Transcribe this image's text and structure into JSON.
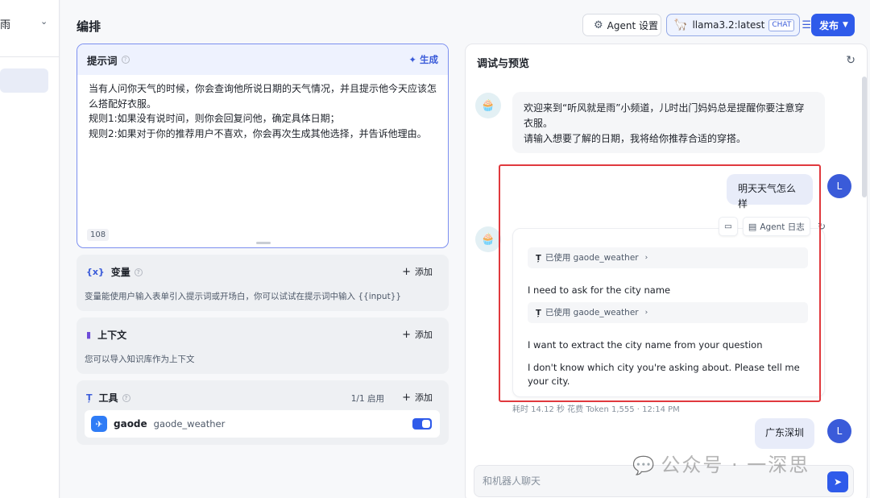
{
  "nav": {
    "partial_label": "雨"
  },
  "header": {
    "title": "编排",
    "agent_settings": "Agent 设置",
    "model_name": "llama3.2:latest",
    "model_badge": "CHAT",
    "publish": "发布"
  },
  "prompt": {
    "title": "提示词",
    "generate": "生成",
    "lines": [
      "当有人问你天气的时候，你会查询他所说日期的天气情况，并且提示他今天应该怎么搭配好衣服。",
      "规则1:如果没有说时间，则你会回复问他，确定具体日期；",
      "规则2:如果对于你的推荐用户不喜欢，你会再次生成其他选择，并告诉他理由。"
    ],
    "char_count": "108"
  },
  "variables": {
    "title": "变量",
    "add": "添加",
    "desc": "变量能使用户输入表单引入提示词或开场白，你可以试试在提示词中输入 {{input}}"
  },
  "context": {
    "title": "上下文",
    "add": "添加",
    "desc": "您可以导入知识库作为上下文"
  },
  "tools": {
    "title": "工具",
    "enabled": "1/1 启用",
    "add": "添加",
    "items": [
      {
        "name": "gaode",
        "id": "gaode_weather",
        "enabled": true
      }
    ]
  },
  "preview": {
    "title": "调试与预览",
    "welcome": [
      "欢迎来到“听风就是雨”小频道，儿时出门妈妈总是提醒你要注意穿衣服。",
      "请输入想要了解的日期，我将给你推荐合适的穿搭。"
    ],
    "user_msg_1": "明天天气怎么样",
    "user_avatar": "L",
    "actions": {
      "agent_log": "Agent 日志"
    },
    "tool_use_label": "已使用 gaode_weather",
    "answer_lines": [
      "I need to ask for the city name",
      "I want to extract the city name from your question",
      "I don't know which city you're asking about. Please tell me your city."
    ],
    "meta": "耗时 14.12 秒  花费 Token 1,555  ·  12:14 PM",
    "user_msg_2": "广东深圳",
    "input_placeholder": "和机器人聊天"
  },
  "watermark": "公众号 · 一深思"
}
